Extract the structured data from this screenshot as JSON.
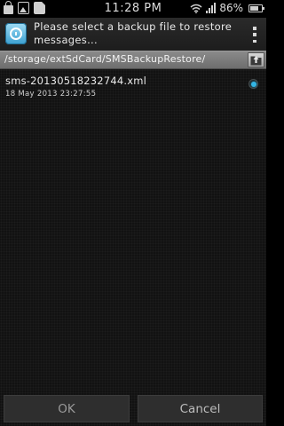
{
  "status_bar": {
    "time": "11:28",
    "am_pm": "PM",
    "battery_percent": "86%",
    "battery_level": 0.86,
    "icons": [
      "lock-icon",
      "image-icon",
      "file-icon",
      "wifi-icon",
      "signal-icon",
      "battery-icon"
    ]
  },
  "header": {
    "title": "Please select a backup file to restore messages...",
    "app_icon": "backup-restore-app-icon",
    "menu_icon": "overflow-menu-icon"
  },
  "path_bar": {
    "path": "/storage/extSdCard/SMSBackupRestore/",
    "up_icon": "folder-up-icon"
  },
  "files": [
    {
      "name": "sms-20130518232744.xml",
      "date": "18 May 2013 23:27:55",
      "selected": true
    }
  ],
  "buttons": {
    "ok_label": "OK",
    "cancel_label": "Cancel"
  },
  "colors": {
    "accent": "#33b5e5",
    "background": "#121212"
  }
}
